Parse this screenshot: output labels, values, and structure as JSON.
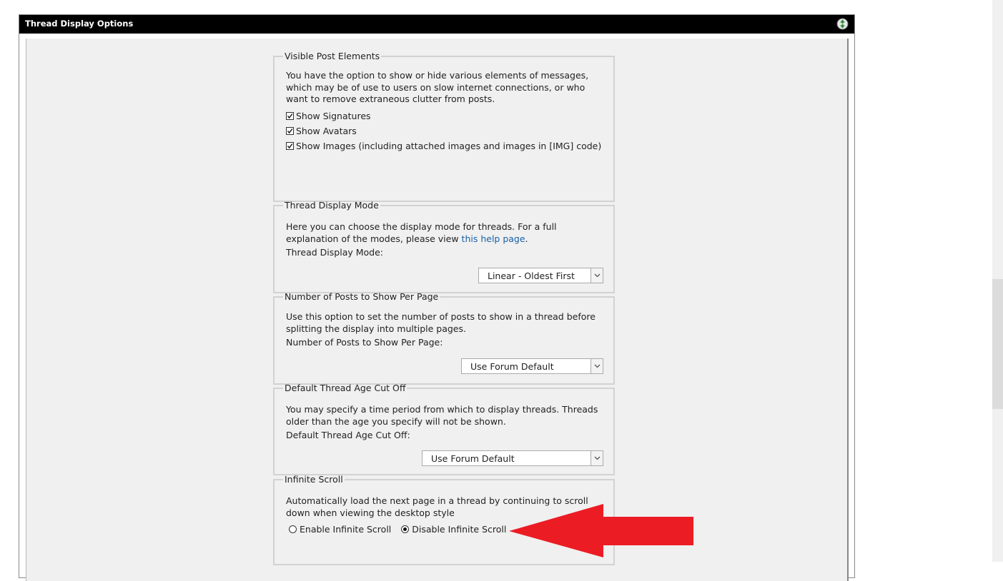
{
  "panel": {
    "title": "Thread Display Options",
    "collapse_icon": "collapse-arrows-icon"
  },
  "visible_post_elements": {
    "legend": "Visible Post Elements",
    "description": "You have the option to show or hide various elements of messages, which may be of use to users on slow internet connections, or who want to remove extraneous clutter from posts.",
    "options": [
      {
        "label": "Show Signatures",
        "checked": true
      },
      {
        "label": "Show Avatars",
        "checked": true
      },
      {
        "label": "Show Images (including attached images and images in [IMG] code)",
        "checked": true
      }
    ]
  },
  "thread_display_mode": {
    "legend": "Thread Display Mode",
    "description_before_link": "Here you can choose the display mode for threads. For a full explanation of the modes, please view ",
    "link_text": "this help page",
    "description_after_link": ".",
    "field_label": "Thread Display Mode:",
    "selected_value": "Linear - Oldest First"
  },
  "posts_per_page": {
    "legend": "Number of Posts to Show Per Page",
    "description": "Use this option to set the number of posts to show in a thread before splitting the display into multiple pages.",
    "field_label": "Number of Posts to Show Per Page:",
    "selected_value": "Use Forum Default"
  },
  "age_cutoff": {
    "legend": "Default Thread Age Cut Off",
    "description": "You may specify a time period from which to display threads. Threads older than the age you specify will not be shown.",
    "field_label": "Default Thread Age Cut Off:",
    "selected_value": "Use Forum Default"
  },
  "infinite_scroll": {
    "legend": "Infinite Scroll",
    "description": "Automatically load the next page in a thread by continuing to scroll down when viewing the desktop style",
    "options": [
      {
        "label": "Enable Infinite Scroll",
        "selected": false
      },
      {
        "label": "Disable Infinite Scroll",
        "selected": true
      }
    ]
  },
  "annotation": {
    "arrow_color": "#ec1c24",
    "arrow_icon": "red-pointer-arrow-icon"
  },
  "colors": {
    "header_bg": "#000000",
    "body_bg": "#f0f0f0",
    "link": "#1a5fa8"
  }
}
